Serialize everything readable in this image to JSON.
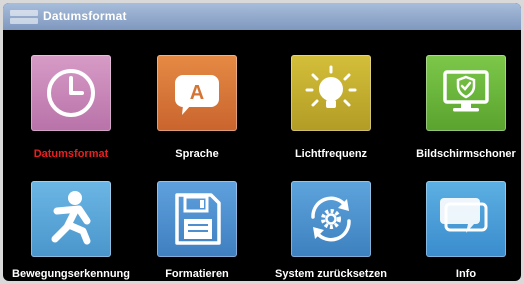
{
  "title": "Datumsformat",
  "colors": {
    "selected_label": "#e8201f",
    "label": "#ffffff",
    "titlebar": "#8fa8cc",
    "background": "#000000"
  },
  "items": [
    {
      "label": "Datumsformat",
      "icon": "clock-icon",
      "color": "#c987b9",
      "selected": true
    },
    {
      "label": "Sprache",
      "icon": "speech-bubble-a-icon",
      "color": "#d9753a",
      "selected": false
    },
    {
      "label": "Lichtfrequenz",
      "icon": "light-bulb-icon",
      "color": "#c6b02e",
      "selected": false
    },
    {
      "label": "Bildschirmschoner",
      "icon": "monitor-shield-icon",
      "color": "#6cb83a",
      "selected": false
    },
    {
      "label": "Bewegungserkennung",
      "icon": "motion-person-icon",
      "color": "#5aa7d8",
      "selected": false
    },
    {
      "label": "Formatieren",
      "icon": "floppy-disk-icon",
      "color": "#4f8fd0",
      "selected": false
    },
    {
      "label": "System zurücksetzen",
      "icon": "reset-gear-icon",
      "color": "#4d93cf",
      "selected": false
    },
    {
      "label": "Info",
      "icon": "info-bubble-icon",
      "color": "#4aa0d8",
      "selected": false
    }
  ]
}
